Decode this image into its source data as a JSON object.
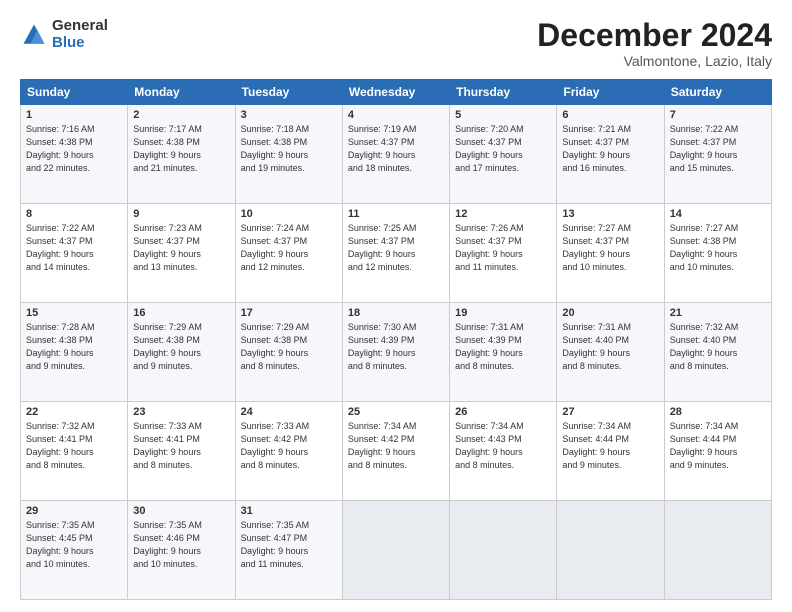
{
  "logo": {
    "general": "General",
    "blue": "Blue"
  },
  "title": "December 2024",
  "location": "Valmontone, Lazio, Italy",
  "days_header": [
    "Sunday",
    "Monday",
    "Tuesday",
    "Wednesday",
    "Thursday",
    "Friday",
    "Saturday"
  ],
  "weeks": [
    [
      {
        "day": "1",
        "lines": [
          "Sunrise: 7:16 AM",
          "Sunset: 4:38 PM",
          "Daylight: 9 hours",
          "and 22 minutes."
        ]
      },
      {
        "day": "2",
        "lines": [
          "Sunrise: 7:17 AM",
          "Sunset: 4:38 PM",
          "Daylight: 9 hours",
          "and 21 minutes."
        ]
      },
      {
        "day": "3",
        "lines": [
          "Sunrise: 7:18 AM",
          "Sunset: 4:38 PM",
          "Daylight: 9 hours",
          "and 19 minutes."
        ]
      },
      {
        "day": "4",
        "lines": [
          "Sunrise: 7:19 AM",
          "Sunset: 4:37 PM",
          "Daylight: 9 hours",
          "and 18 minutes."
        ]
      },
      {
        "day": "5",
        "lines": [
          "Sunrise: 7:20 AM",
          "Sunset: 4:37 PM",
          "Daylight: 9 hours",
          "and 17 minutes."
        ]
      },
      {
        "day": "6",
        "lines": [
          "Sunrise: 7:21 AM",
          "Sunset: 4:37 PM",
          "Daylight: 9 hours",
          "and 16 minutes."
        ]
      },
      {
        "day": "7",
        "lines": [
          "Sunrise: 7:22 AM",
          "Sunset: 4:37 PM",
          "Daylight: 9 hours",
          "and 15 minutes."
        ]
      }
    ],
    [
      {
        "day": "8",
        "lines": [
          "Sunrise: 7:22 AM",
          "Sunset: 4:37 PM",
          "Daylight: 9 hours",
          "and 14 minutes."
        ]
      },
      {
        "day": "9",
        "lines": [
          "Sunrise: 7:23 AM",
          "Sunset: 4:37 PM",
          "Daylight: 9 hours",
          "and 13 minutes."
        ]
      },
      {
        "day": "10",
        "lines": [
          "Sunrise: 7:24 AM",
          "Sunset: 4:37 PM",
          "Daylight: 9 hours",
          "and 12 minutes."
        ]
      },
      {
        "day": "11",
        "lines": [
          "Sunrise: 7:25 AM",
          "Sunset: 4:37 PM",
          "Daylight: 9 hours",
          "and 12 minutes."
        ]
      },
      {
        "day": "12",
        "lines": [
          "Sunrise: 7:26 AM",
          "Sunset: 4:37 PM",
          "Daylight: 9 hours",
          "and 11 minutes."
        ]
      },
      {
        "day": "13",
        "lines": [
          "Sunrise: 7:27 AM",
          "Sunset: 4:37 PM",
          "Daylight: 9 hours",
          "and 10 minutes."
        ]
      },
      {
        "day": "14",
        "lines": [
          "Sunrise: 7:27 AM",
          "Sunset: 4:38 PM",
          "Daylight: 9 hours",
          "and 10 minutes."
        ]
      }
    ],
    [
      {
        "day": "15",
        "lines": [
          "Sunrise: 7:28 AM",
          "Sunset: 4:38 PM",
          "Daylight: 9 hours",
          "and 9 minutes."
        ]
      },
      {
        "day": "16",
        "lines": [
          "Sunrise: 7:29 AM",
          "Sunset: 4:38 PM",
          "Daylight: 9 hours",
          "and 9 minutes."
        ]
      },
      {
        "day": "17",
        "lines": [
          "Sunrise: 7:29 AM",
          "Sunset: 4:38 PM",
          "Daylight: 9 hours",
          "and 8 minutes."
        ]
      },
      {
        "day": "18",
        "lines": [
          "Sunrise: 7:30 AM",
          "Sunset: 4:39 PM",
          "Daylight: 9 hours",
          "and 8 minutes."
        ]
      },
      {
        "day": "19",
        "lines": [
          "Sunrise: 7:31 AM",
          "Sunset: 4:39 PM",
          "Daylight: 9 hours",
          "and 8 minutes."
        ]
      },
      {
        "day": "20",
        "lines": [
          "Sunrise: 7:31 AM",
          "Sunset: 4:40 PM",
          "Daylight: 9 hours",
          "and 8 minutes."
        ]
      },
      {
        "day": "21",
        "lines": [
          "Sunrise: 7:32 AM",
          "Sunset: 4:40 PM",
          "Daylight: 9 hours",
          "and 8 minutes."
        ]
      }
    ],
    [
      {
        "day": "22",
        "lines": [
          "Sunrise: 7:32 AM",
          "Sunset: 4:41 PM",
          "Daylight: 9 hours",
          "and 8 minutes."
        ]
      },
      {
        "day": "23",
        "lines": [
          "Sunrise: 7:33 AM",
          "Sunset: 4:41 PM",
          "Daylight: 9 hours",
          "and 8 minutes."
        ]
      },
      {
        "day": "24",
        "lines": [
          "Sunrise: 7:33 AM",
          "Sunset: 4:42 PM",
          "Daylight: 9 hours",
          "and 8 minutes."
        ]
      },
      {
        "day": "25",
        "lines": [
          "Sunrise: 7:34 AM",
          "Sunset: 4:42 PM",
          "Daylight: 9 hours",
          "and 8 minutes."
        ]
      },
      {
        "day": "26",
        "lines": [
          "Sunrise: 7:34 AM",
          "Sunset: 4:43 PM",
          "Daylight: 9 hours",
          "and 8 minutes."
        ]
      },
      {
        "day": "27",
        "lines": [
          "Sunrise: 7:34 AM",
          "Sunset: 4:44 PM",
          "Daylight: 9 hours",
          "and 9 minutes."
        ]
      },
      {
        "day": "28",
        "lines": [
          "Sunrise: 7:34 AM",
          "Sunset: 4:44 PM",
          "Daylight: 9 hours",
          "and 9 minutes."
        ]
      }
    ],
    [
      {
        "day": "29",
        "lines": [
          "Sunrise: 7:35 AM",
          "Sunset: 4:45 PM",
          "Daylight: 9 hours",
          "and 10 minutes."
        ]
      },
      {
        "day": "30",
        "lines": [
          "Sunrise: 7:35 AM",
          "Sunset: 4:46 PM",
          "Daylight: 9 hours",
          "and 10 minutes."
        ]
      },
      {
        "day": "31",
        "lines": [
          "Sunrise: 7:35 AM",
          "Sunset: 4:47 PM",
          "Daylight: 9 hours",
          "and 11 minutes."
        ]
      },
      {
        "day": "",
        "lines": []
      },
      {
        "day": "",
        "lines": []
      },
      {
        "day": "",
        "lines": []
      },
      {
        "day": "",
        "lines": []
      }
    ]
  ]
}
